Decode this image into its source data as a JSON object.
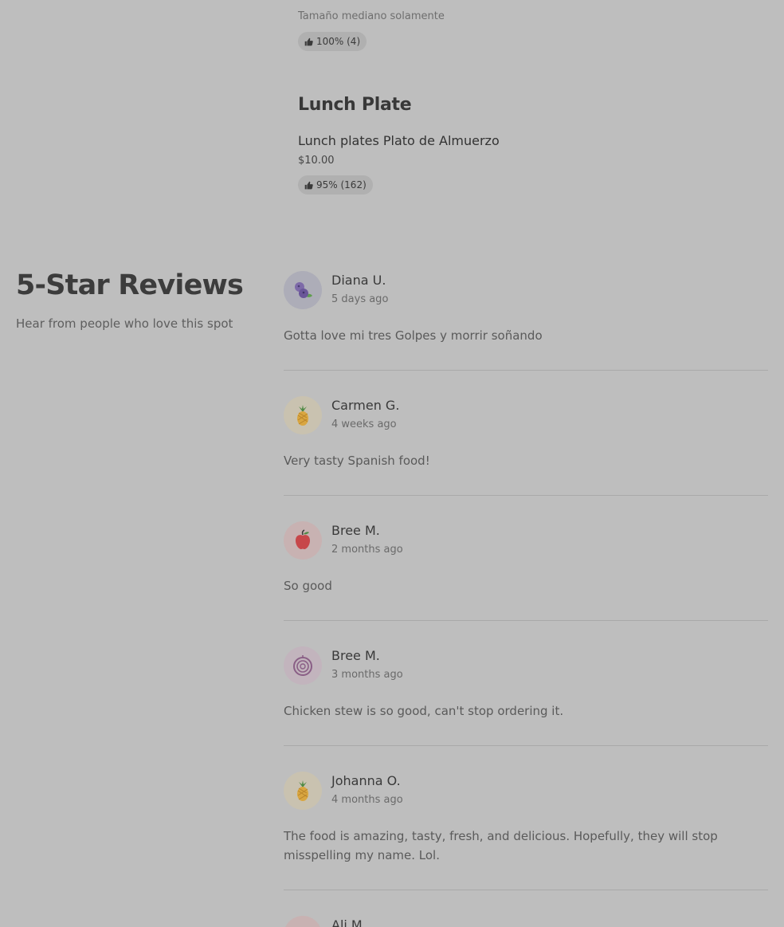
{
  "menu": {
    "prev_item": {
      "note": "Tamaño mediano solamente",
      "rating": "100% (4)"
    },
    "section_title": "Lunch Plate",
    "item": {
      "name": "Lunch plates Plato de Almuerzo",
      "price": "$10.00",
      "rating": "95% (162)"
    }
  },
  "reviews_section": {
    "heading": "5-Star Reviews",
    "subheading": "Hear from people who love this spot",
    "reviews": [
      {
        "name": "Diana U.",
        "date": "5 days ago",
        "text": "Gotta love mi tres Golpes y morrir soñando",
        "avatar_icon": "blueberry-icon",
        "avatar_bg": "#adadb8"
      },
      {
        "name": "Carmen G.",
        "date": "4 weeks ago",
        "text": "Very tasty Spanish food!",
        "avatar_icon": "pineapple-icon",
        "avatar_bg": "#c9c2b0"
      },
      {
        "name": "Bree M.",
        "date": "2 months ago",
        "text": "So good",
        "avatar_icon": "apple-icon",
        "avatar_bg": "#c8b2b2"
      },
      {
        "name": "Bree M.",
        "date": "3 months ago",
        "text": "Chicken stew is so good, can't stop ordering it.",
        "avatar_icon": "onion-icon",
        "avatar_bg": "#c2b4bd"
      },
      {
        "name": "Johanna O.",
        "date": "4 months ago",
        "text": "The food is amazing, tasty, fresh, and delicious. Hopefully, they will stop misspelling my name. Lol.",
        "avatar_icon": "pineapple-icon",
        "avatar_bg": "#c9c2b0"
      },
      {
        "name": "Ali M.",
        "date": "",
        "text": "",
        "avatar_icon": "sprout-icon",
        "avatar_bg": "#c8b2b2"
      }
    ]
  }
}
